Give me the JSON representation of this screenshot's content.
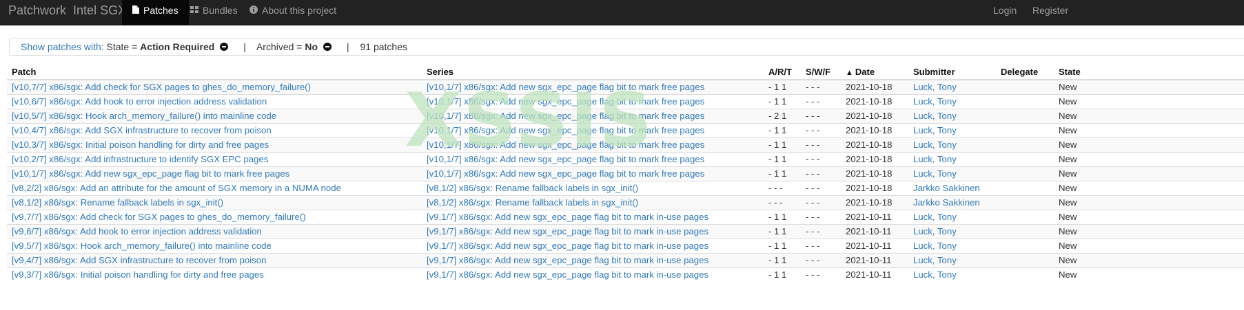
{
  "navbar": {
    "brand": "Patchwork",
    "project": "Intel SGX",
    "items": [
      {
        "label": "Patches",
        "icon": "file-icon"
      },
      {
        "label": "Bundles",
        "icon": "bundles-icon"
      },
      {
        "label": "About this project",
        "icon": "info-icon"
      }
    ],
    "login": "Login",
    "register": "Register"
  },
  "filters": {
    "show_label": "Show patches with:",
    "state_key": "State =",
    "state_value": "Action Required",
    "archived_key": "Archived =",
    "archived_value": "No",
    "count": "91 patches",
    "sep": "|"
  },
  "table": {
    "headers": {
      "patch": "Patch",
      "series": "Series",
      "art": "A/R/T",
      "swf": "S/W/F",
      "date": "Date",
      "submitter": "Submitter",
      "delegate": "Delegate",
      "state": "State"
    },
    "rows": [
      {
        "patch": "[v10,7/7] x86/sgx: Add check for SGX pages to ghes_do_memory_failure()",
        "series": "[v10,1/7] x86/sgx: Add new sgx_epc_page flag bit to mark free pages",
        "art": "- 1 1",
        "swf": "- - -",
        "date": "2021-10-18",
        "submitter": "Luck, Tony",
        "delegate": "",
        "state": "New"
      },
      {
        "patch": "[v10,6/7] x86/sgx: Add hook to error injection address validation",
        "series": "[v10,1/7] x86/sgx: Add new sgx_epc_page flag bit to mark free pages",
        "art": "- 1 1",
        "swf": "- - -",
        "date": "2021-10-18",
        "submitter": "Luck, Tony",
        "delegate": "",
        "state": "New"
      },
      {
        "patch": "[v10,5/7] x86/sgx: Hook arch_memory_failure() into mainline code",
        "series": "[v10,1/7] x86/sgx: Add new sgx_epc_page flag bit to mark free pages",
        "art": "- 2 1",
        "swf": "- - -",
        "date": "2021-10-18",
        "submitter": "Luck, Tony",
        "delegate": "",
        "state": "New"
      },
      {
        "patch": "[v10,4/7] x86/sgx: Add SGX infrastructure to recover from poison",
        "series": "[v10,1/7] x86/sgx: Add new sgx_epc_page flag bit to mark free pages",
        "art": "- 1 1",
        "swf": "- - -",
        "date": "2021-10-18",
        "submitter": "Luck, Tony",
        "delegate": "",
        "state": "New"
      },
      {
        "patch": "[v10,3/7] x86/sgx: Initial poison handling for dirty and free pages",
        "series": "[v10,1/7] x86/sgx: Add new sgx_epc_page flag bit to mark free pages",
        "art": "- 1 1",
        "swf": "- - -",
        "date": "2021-10-18",
        "submitter": "Luck, Tony",
        "delegate": "",
        "state": "New"
      },
      {
        "patch": "[v10,2/7] x86/sgx: Add infrastructure to identify SGX EPC pages",
        "series": "[v10,1/7] x86/sgx: Add new sgx_epc_page flag bit to mark free pages",
        "art": "- 1 1",
        "swf": "- - -",
        "date": "2021-10-18",
        "submitter": "Luck, Tony",
        "delegate": "",
        "state": "New"
      },
      {
        "patch": "[v10,1/7] x86/sgx: Add new sgx_epc_page flag bit to mark free pages",
        "series": "[v10,1/7] x86/sgx: Add new sgx_epc_page flag bit to mark free pages",
        "art": "- 1 1",
        "swf": "- - -",
        "date": "2021-10-18",
        "submitter": "Luck, Tony",
        "delegate": "",
        "state": "New"
      },
      {
        "patch": "[v8,2/2] x86/sgx: Add an attribute for the amount of SGX memory in a NUMA node",
        "series": "[v8,1/2] x86/sgx: Rename fallback labels in sgx_init()",
        "art": "- - -",
        "swf": "- - -",
        "date": "2021-10-18",
        "submitter": "Jarkko Sakkinen",
        "delegate": "",
        "state": "New"
      },
      {
        "patch": "[v8,1/2] x86/sgx: Rename fallback labels in sgx_init()",
        "series": "[v8,1/2] x86/sgx: Rename fallback labels in sgx_init()",
        "art": "- - -",
        "swf": "- - -",
        "date": "2021-10-18",
        "submitter": "Jarkko Sakkinen",
        "delegate": "",
        "state": "New"
      },
      {
        "patch": "[v9,7/7] x86/sgx: Add check for SGX pages to ghes_do_memory_failure()",
        "series": "[v9,1/7] x86/sgx: Add new sgx_epc_page flag bit to mark in-use pages",
        "art": "- 1 1",
        "swf": "- - -",
        "date": "2021-10-11",
        "submitter": "Luck, Tony",
        "delegate": "",
        "state": "New"
      },
      {
        "patch": "[v9,6/7] x86/sgx: Add hook to error injection address validation",
        "series": "[v9,1/7] x86/sgx: Add new sgx_epc_page flag bit to mark in-use pages",
        "art": "- 1 1",
        "swf": "- - -",
        "date": "2021-10-11",
        "submitter": "Luck, Tony",
        "delegate": "",
        "state": "New"
      },
      {
        "patch": "[v9,5/7] x86/sgx: Hook arch_memory_failure() into mainline code",
        "series": "[v9,1/7] x86/sgx: Add new sgx_epc_page flag bit to mark in-use pages",
        "art": "- 1 1",
        "swf": "- - -",
        "date": "2021-10-11",
        "submitter": "Luck, Tony",
        "delegate": "",
        "state": "New"
      },
      {
        "patch": "[v9,4/7] x86/sgx: Add SGX infrastructure to recover from poison",
        "series": "[v9,1/7] x86/sgx: Add new sgx_epc_page flag bit to mark in-use pages",
        "art": "- 1 1",
        "swf": "- - -",
        "date": "2021-10-11",
        "submitter": "Luck, Tony",
        "delegate": "",
        "state": "New"
      },
      {
        "patch": "[v9,3/7] x86/sgx: Initial poison handling for dirty and free pages",
        "series": "[v9,1/7] x86/sgx: Add new sgx_epc_page flag bit to mark in-use pages",
        "art": "- 1 1",
        "swf": "- - -",
        "date": "2021-10-11",
        "submitter": "Luck, Tony",
        "delegate": "",
        "state": "New"
      }
    ]
  },
  "watermark": "XSSIS"
}
